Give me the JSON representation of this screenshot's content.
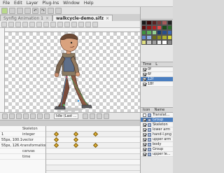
{
  "menu": [
    "File",
    "Edit",
    "Layer",
    "Plug-Ins",
    "Window",
    "Help"
  ],
  "tabs": [
    {
      "label": "Synfig Animation 1",
      "active": false
    },
    {
      "label": "walkcycle-demo.sifz",
      "active": true
    }
  ],
  "timebar": {
    "mode_label": "Idle (Last ..."
  },
  "params": [
    {
      "key": "",
      "value": "Skeleton"
    },
    {
      "key": "",
      "value": "integer"
    },
    {
      "key": "",
      "value": "vector"
    },
    {
      "key": "",
      "value": "transformation"
    },
    {
      "key": "",
      "value": "canvas"
    },
    {
      "key": "",
      "value": "time"
    }
  ],
  "params_values_left": [
    "",
    "1",
    "55px, 100.165pt",
    "55px, 126.424px",
    "",
    ""
  ],
  "keyframes_header": {
    "col1": "Time",
    "col2": "L"
  },
  "keyframes": [
    {
      "time": "0f",
      "selected": false
    },
    {
      "time": "6f",
      "selected": false
    },
    {
      "time": "12f",
      "selected": true
    },
    {
      "time": "18f",
      "selected": false
    }
  ],
  "layers_header": {
    "col1": "Icon",
    "col2": "Name"
  },
  "layers": [
    {
      "name": "Translat...",
      "checked": false,
      "selected": false
    },
    {
      "name": "Group",
      "checked": true,
      "selected": true
    },
    {
      "name": "Skeleton",
      "checked": true,
      "selected": false
    },
    {
      "name": "lower arm",
      "checked": true,
      "selected": false
    },
    {
      "name": "hand-l.png",
      "checked": true,
      "selected": false
    },
    {
      "name": "upper arm",
      "checked": true,
      "selected": false
    },
    {
      "name": "body",
      "checked": true,
      "selected": false
    },
    {
      "name": "Group",
      "checked": true,
      "selected": false
    },
    {
      "name": "upper le...",
      "checked": true,
      "selected": false
    }
  ],
  "palette_colors": [
    "#1a1a1a",
    "#3a0a0a",
    "#5a2222",
    "#7a3a3a",
    "#a45a5a",
    "#222222",
    "#5b0d0d",
    "#8b1a1a",
    "#b32222",
    "#d94a4a",
    "#1b4b1b",
    "#2c6e2c",
    "#3d8f3d",
    "#5fb05f",
    "#95d095",
    "#1a3b6b",
    "#294f8c",
    "#3d67b0",
    "#5f86cc",
    "#93afe0",
    "#6b6b1a",
    "#8c8c22",
    "#b0b02c",
    "#d4d440",
    "#e0e080",
    "#c8c8c8",
    "#a0a0a0",
    "#f0f0f0",
    "#ffffff",
    "#888888"
  ]
}
